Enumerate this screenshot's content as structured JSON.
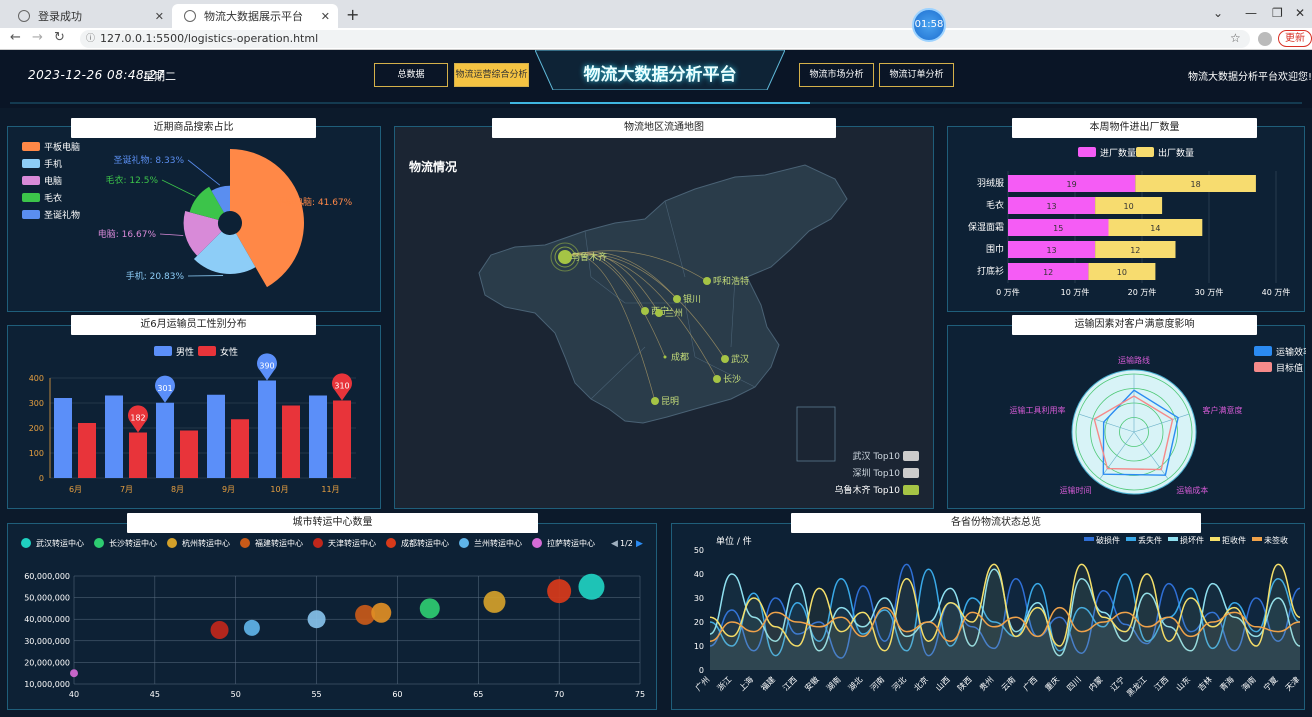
{
  "browser": {
    "tabs": [
      {
        "title": "登录成功",
        "close": "✕"
      },
      {
        "title": "物流大数据展示平台",
        "close": "✕"
      }
    ],
    "new_tab": "+",
    "url": "127.0.0.1:5500/logistics-operation.html",
    "update_label": "更新",
    "timer": "01:58"
  },
  "header": {
    "datetime": "2023-12-26 08:48:27",
    "weekday": "星期二",
    "nav": [
      "总数据",
      "物流运营综合分析",
      "物流市场分析",
      "物流订单分析"
    ],
    "active_nav": 1,
    "title": "物流大数据分析平台",
    "welcome": "物流大数据分析平台欢迎您!"
  },
  "panels": {
    "search_share": {
      "title": "近期商品搜索占比"
    },
    "gender": {
      "title": "近6月运输员工性别分布"
    },
    "map": {
      "title": "物流地区流通地图",
      "subtitle": "物流情况"
    },
    "factory": {
      "title": "本周物件进出厂数量"
    },
    "satisfaction": {
      "title": "运输因素对客户满意度影响"
    },
    "city_hubs": {
      "title": "城市转运中心数量"
    },
    "province_status": {
      "title": "各省份物流状态总览"
    }
  },
  "colors": {
    "accent": "#f5c342",
    "panel_border": "#1f5e7a",
    "title_glow": "#35d5f5"
  },
  "chart_data": [
    {
      "id": "search_share",
      "type": "pie",
      "variant": "rose",
      "labels": [
        "平板电脑",
        "手机",
        "电脑",
        "毛衣",
        "圣诞礼物"
      ],
      "values": [
        41.67,
        20.83,
        16.67,
        12.5,
        8.33
      ],
      "slice_labels": [
        "平板电脑: 41.67%",
        "手机: 20.83%",
        "电脑: 16.67%",
        "毛衣: 12.5%",
        "圣诞礼物: 8.33%"
      ],
      "colors": [
        "#ff8847",
        "#8dcdf7",
        "#d88ad8",
        "#3cc44a",
        "#5a8ef0"
      ],
      "legend": "top-left"
    },
    {
      "id": "gender",
      "type": "bar",
      "categories": [
        "6月",
        "7月",
        "8月",
        "9月",
        "10月",
        "11月"
      ],
      "series": [
        {
          "name": "男性",
          "values": [
            320,
            330,
            301,
            333,
            390,
            330
          ],
          "color": "#5b8ff9"
        },
        {
          "name": "女性",
          "values": [
            220,
            182,
            190,
            235,
            290,
            310
          ],
          "color": "#e8343a"
        }
      ],
      "pins": [
        {
          "series": 0,
          "index": 2,
          "label": "301"
        },
        {
          "series": 1,
          "index": 1,
          "label": "182"
        },
        {
          "series": 0,
          "index": 4,
          "label": "390"
        },
        {
          "series": 1,
          "index": 5,
          "label": "310"
        }
      ],
      "ylim": [
        0,
        400
      ],
      "yticks": [
        "0",
        "100",
        "200",
        "300",
        "400"
      ],
      "grid": true,
      "legend": "top-center"
    },
    {
      "id": "map",
      "type": "map",
      "cities": [
        "乌鲁木齐",
        "呼和浩特",
        "银川",
        "西宁",
        "兰州",
        "成都",
        "武汉",
        "长沙",
        "昆明"
      ],
      "legend": [
        "武汉 Top10",
        "深圳 Top10",
        "乌鲁木齐 Top10"
      ],
      "legend_colors": [
        "#cccccc",
        "#cccccc",
        "#a5c445"
      ],
      "legend_active": 2
    },
    {
      "id": "factory",
      "type": "bar",
      "orientation": "horizontal",
      "stacked": true,
      "categories": [
        "羽绒服",
        "毛衣",
        "保湿面霜",
        "围巾",
        "打底衫"
      ],
      "series": [
        {
          "name": "进厂数量",
          "values": [
            19,
            13,
            15,
            13,
            12
          ],
          "color": "#f55cf5"
        },
        {
          "name": "出厂数量",
          "values": [
            18,
            10,
            14,
            12,
            10
          ],
          "color": "#f7dc6f"
        }
      ],
      "xlim": [
        0,
        40
      ],
      "xticks": [
        "0 万件",
        "10 万件",
        "20 万件",
        "30 万件",
        "40 万件"
      ],
      "legend": "top-center"
    },
    {
      "id": "satisfaction",
      "type": "radar",
      "indicators": [
        "运输路线",
        "客户满意度",
        "运输成本",
        "运输时间",
        "运输工具利用率"
      ],
      "series": [
        {
          "name": "运输效率",
          "values": [
            0.72,
            0.8,
            0.92,
            0.9,
            0.55
          ],
          "color": "#2b8bf2"
        },
        {
          "name": "目标值",
          "values": [
            0.62,
            0.7,
            0.8,
            0.78,
            0.72
          ],
          "color": "#f58a8a"
        }
      ],
      "legend": "top-right"
    },
    {
      "id": "city_hubs",
      "type": "scatter",
      "legend": [
        "武汉转运中心",
        "长沙转运中心",
        "杭州转运中心",
        "福建转运中心",
        "天津转运中心",
        "成都转运中心",
        "兰州转运中心",
        "拉萨转运中心"
      ],
      "legend_page": "1/2",
      "points": [
        {
          "x": 72,
          "y": 55000000,
          "r": 13,
          "color": "#1fd1c1"
        },
        {
          "x": 62,
          "y": 45000000,
          "r": 10,
          "color": "#2ecc71"
        },
        {
          "x": 66,
          "y": 48000000,
          "r": 11,
          "color": "#d4a12a"
        },
        {
          "x": 58,
          "y": 42000000,
          "r": 10,
          "color": "#c85a19"
        },
        {
          "x": 59,
          "y": 43000000,
          "r": 10,
          "color": "#e08e24"
        },
        {
          "x": 70,
          "y": 53000000,
          "r": 12,
          "color": "#d83a1a"
        },
        {
          "x": 49,
          "y": 35000000,
          "r": 9,
          "color": "#c0271b"
        },
        {
          "x": 51,
          "y": 36000000,
          "r": 8,
          "color": "#5fb4e8"
        },
        {
          "x": 55,
          "y": 40000000,
          "r": 9,
          "color": "#85c1e9"
        },
        {
          "x": 40,
          "y": 15000000,
          "r": 4,
          "color": "#d56bd6"
        }
      ],
      "xlim": [
        40,
        75
      ],
      "xticks": [
        "40",
        "45",
        "50",
        "55",
        "60",
        "65",
        "70",
        "75"
      ],
      "ylim": [
        10000000,
        60000000
      ],
      "yticks": [
        "10,000,000",
        "20,000,000",
        "30,000,000",
        "40,000,000",
        "50,000,000",
        "60,000,000"
      ]
    },
    {
      "id": "province_status",
      "type": "line",
      "smooth": true,
      "unit_label": "单位 / 件",
      "categories": [
        "广州",
        "浙江",
        "上海",
        "福建",
        "江西",
        "安徽",
        "湖南",
        "湖北",
        "河南",
        "河北",
        "北京",
        "山西",
        "陕西",
        "贵州",
        "云南",
        "广西",
        "重庆",
        "四川",
        "内蒙",
        "辽宁",
        "黑龙江",
        "江西",
        "山东",
        "吉林",
        "青海",
        "海南",
        "宁夏",
        "天津"
      ],
      "series": [
        {
          "name": "破损件",
          "color": "#2f6fd6",
          "values": [
            10,
            25,
            8,
            30,
            15,
            20,
            5,
            35,
            12,
            44,
            6,
            28,
            18,
            9,
            38,
            14,
            22,
            7,
            33,
            19,
            11,
            36,
            16,
            24,
            8,
            30,
            12,
            34
          ]
        },
        {
          "name": "丢失件",
          "color": "#39a9e8",
          "values": [
            20,
            10,
            32,
            6,
            28,
            12,
            38,
            15,
            25,
            8,
            42,
            10,
            30,
            20,
            14,
            36,
            8,
            26,
            18,
            40,
            12,
            22,
            34,
            9,
            28,
            16,
            38,
            20
          ]
        },
        {
          "name": "损坏件",
          "color": "#8fe0f0",
          "values": [
            15,
            40,
            22,
            12,
            36,
            8,
            26,
            18,
            30,
            14,
            20,
            34,
            10,
            42,
            16,
            28,
            6,
            38,
            24,
            12,
            32,
            18,
            8,
            36,
            22,
            14,
            30,
            10
          ]
        },
        {
          "name": "拒收件",
          "color": "#f5e06a",
          "values": [
            22,
            14,
            30,
            18,
            10,
            34,
            16,
            24,
            8,
            38,
            12,
            28,
            20,
            44,
            14,
            26,
            10,
            44,
            22,
            16,
            40,
            12,
            30,
            18,
            26,
            10,
            44,
            22
          ]
        },
        {
          "name": "未签收",
          "color": "#f0a24a",
          "values": [
            12,
            20,
            16,
            24,
            20,
            18,
            22,
            14,
            26,
            16,
            20,
            12,
            24,
            18,
            22,
            14,
            26,
            16,
            20,
            24,
            18,
            22,
            14,
            20,
            24,
            18,
            16,
            20
          ]
        }
      ],
      "ylim": [
        0,
        50
      ],
      "yticks": [
        "0",
        "10",
        "20",
        "30",
        "40",
        "50"
      ],
      "legend": "top-right"
    }
  ]
}
